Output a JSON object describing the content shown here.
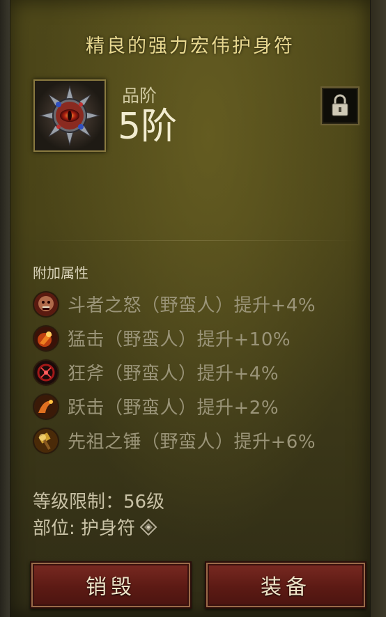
{
  "item": {
    "name": "精良的强力宏伟护身符",
    "tier_label": "品阶",
    "tier_value": "5阶"
  },
  "affixes_section": {
    "title": "附加属性",
    "items": [
      {
        "text": "斗者之怒（野蛮人）提升+4%",
        "icon": "rage-face-icon"
      },
      {
        "text": "猛击（野蛮人）提升+10%",
        "icon": "bash-icon"
      },
      {
        "text": "狂斧（野蛮人）提升+4%",
        "icon": "frenzy-axe-icon"
      },
      {
        "text": "跃击（野蛮人）提升+2%",
        "icon": "leap-icon"
      },
      {
        "text": "先祖之锤（野蛮人）提升+6%",
        "icon": "ancestral-hammer-icon"
      }
    ]
  },
  "requirements": {
    "level": "等级限制：56级",
    "slot": "部位: 护身符"
  },
  "buttons": {
    "salvage": "销毁",
    "equip": "装备"
  },
  "colors": {
    "title": "#e8d890",
    "affix_text": "#9a9478",
    "button_red": "#6a1e18",
    "panel": "#4a4418"
  }
}
